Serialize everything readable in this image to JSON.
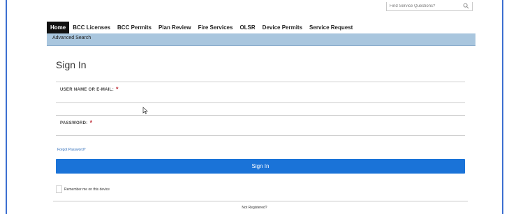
{
  "header": {
    "search_placeholder": "Find Service Questions?"
  },
  "nav": {
    "tabs": [
      {
        "label": "Home",
        "active": true
      },
      {
        "label": "BCC Licenses"
      },
      {
        "label": "BCC Permits"
      },
      {
        "label": "Plan Review"
      },
      {
        "label": "Fire Services"
      },
      {
        "label": "OLSR"
      },
      {
        "label": "Device Permits"
      },
      {
        "label": "Service Request"
      }
    ],
    "sub_link": "Advanced Search"
  },
  "form": {
    "title": "Sign In",
    "username_label": "USER NAME OR E-MAIL:",
    "username_required": "*",
    "username_value": "",
    "password_label": "PASSWORD:",
    "password_required": "*",
    "password_value": "",
    "forgot_link": "Forgot Password?",
    "submit_label": "Sign In",
    "remember_label": "Remember me on this device",
    "remember_checked": false,
    "not_registered": "Not Registered?"
  },
  "colors": {
    "accent": "#1a73d8",
    "nav_subbar": "#a9c6de",
    "required": "#c0303b",
    "frame": "#3c6fd1"
  }
}
